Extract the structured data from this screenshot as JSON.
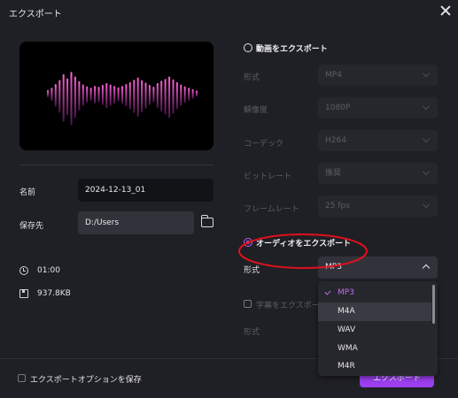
{
  "window": {
    "title": "エクスポート"
  },
  "info": {
    "name_label": "名前",
    "name_value": "2024-12-13_01",
    "path_label": "保存先",
    "path_value": "D:/Users",
    "duration": "01:00",
    "size": "937.8KB"
  },
  "video_export": {
    "label": "動画をエクスポート",
    "rows": [
      {
        "label": "形式",
        "value": "MP4"
      },
      {
        "label": "解像度",
        "value": "1080P"
      },
      {
        "label": "コーデック",
        "value": "H264"
      },
      {
        "label": "ビットレート",
        "value": "推奨"
      },
      {
        "label": "フレームレート",
        "value": "25  fps"
      }
    ]
  },
  "audio_export": {
    "label": "オーディオをエクスポート",
    "format_label": "形式",
    "format_value": "MP3",
    "subtitle_label": "字幕をエクスポート",
    "format2_label": "形式",
    "options": [
      "MP3",
      "M4A",
      "WAV",
      "WMA",
      "M4R"
    ],
    "selected_index": 0,
    "hover_index": 1
  },
  "footer": {
    "save_option_label": "エクスポートオプションを保存",
    "export_button": "エクスポート"
  },
  "colors": {
    "accent": "#9b3ff0",
    "selected_text": "#c06cf0",
    "annotation": "#e0101e",
    "wave_top": "#ff62d9",
    "wave_bottom": "#4a1248"
  },
  "waveform": {
    "bars": [
      0.12,
      0.22,
      0.38,
      0.55,
      0.8,
      0.62,
      0.9,
      0.7,
      0.5,
      0.36,
      0.28,
      0.22,
      0.3,
      0.26,
      0.34,
      0.42,
      0.36,
      0.3,
      0.24,
      0.3,
      0.38,
      0.46,
      0.56,
      0.66,
      0.54,
      0.44,
      0.34,
      0.26,
      0.42,
      0.52,
      0.6,
      0.7,
      0.58,
      0.46,
      0.36,
      0.28,
      0.22,
      0.16,
      0.1
    ]
  }
}
